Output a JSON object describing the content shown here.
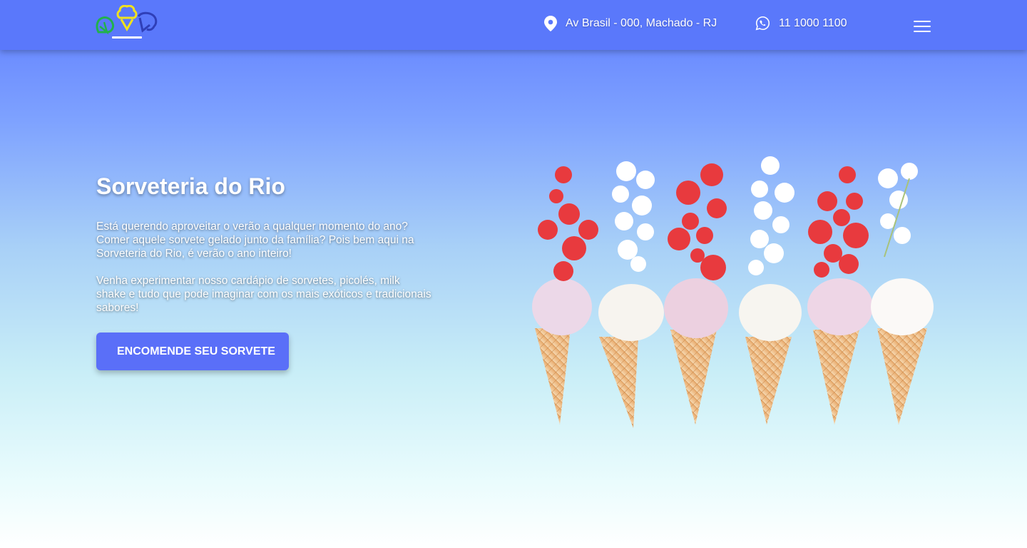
{
  "header": {
    "logo_alt": "Sorveteria do Rio logo",
    "address": "Av Brasil - 000, Machado - RJ",
    "phone": "11 1000 1100",
    "icons": {
      "address": "location-pin-icon",
      "phone": "whatsapp-icon",
      "menu": "hamburger-menu-icon"
    }
  },
  "hero": {
    "title": "Sorveteria do Rio",
    "paragraph1": "Está querendo aproveitar o verão a qualquer momento do ano? Comer aquele sorvete gelado junto da família? Pois bem aqui na Sorveteria do Rio, é verão o ano inteiro!",
    "paragraph2": "Venha experimentar nosso cardápio de sorvetes, picolés, milk shake e tudo que pode imaginar com os mais exóticos e tradicionais sabores!",
    "cta_label": "ENCOMENDE SEU SORVETE",
    "image_alt": "Casquinhas de sorvete com morangos e flores"
  },
  "colors": {
    "header_bg": "#5a78fb",
    "cta_bg": "#5a6ff8",
    "logo_green": "#22b14c",
    "logo_yellow": "#f1e21c",
    "logo_blue": "#2f3fb8"
  }
}
